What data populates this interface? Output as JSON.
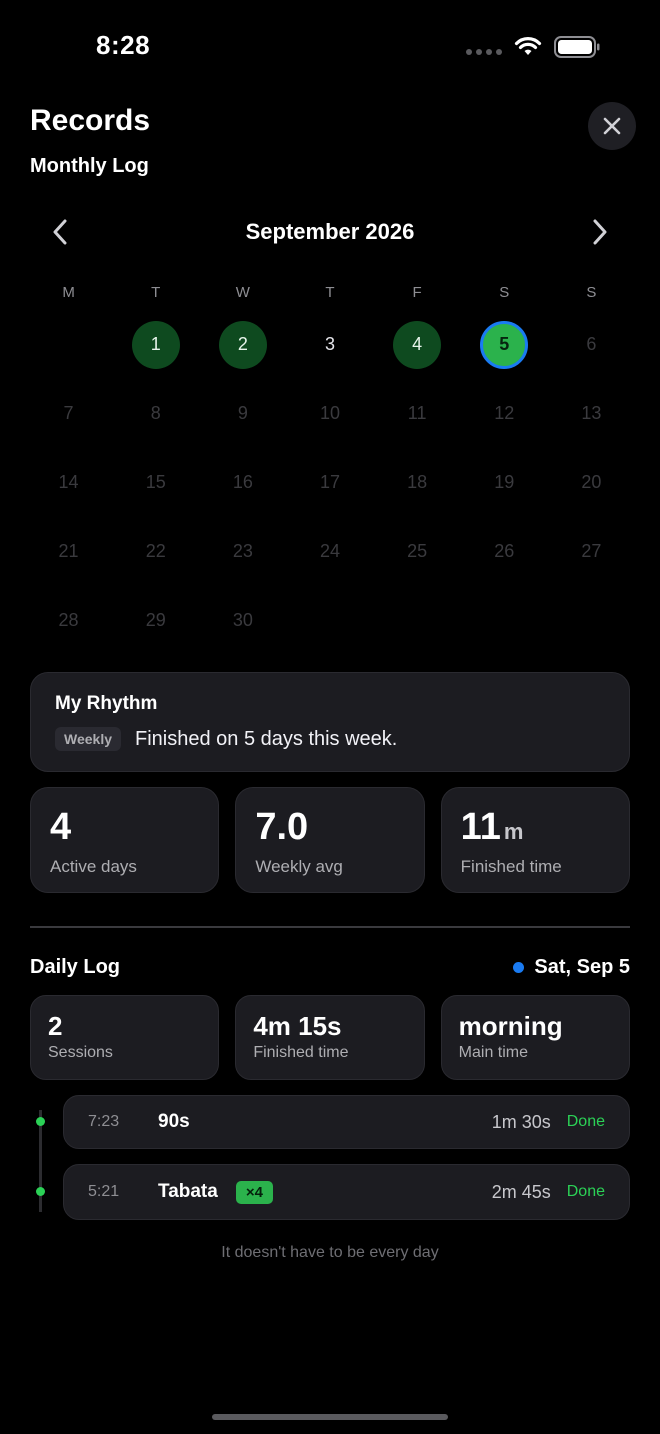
{
  "status_bar": {
    "time": "8:28"
  },
  "header": {
    "title": "Records",
    "subtitle": "Monthly Log"
  },
  "calendar": {
    "month_label": "September 2026",
    "weekdays": [
      "M",
      "T",
      "W",
      "T",
      "F",
      "S",
      "S"
    ],
    "leading_blank_days": 1,
    "days": [
      "1",
      "2",
      "3",
      "4",
      "5",
      "6",
      "7",
      "8",
      "9",
      "10",
      "11",
      "12",
      "13",
      "14",
      "15",
      "16",
      "17",
      "18",
      "19",
      "20",
      "21",
      "22",
      "23",
      "24",
      "25",
      "26",
      "27",
      "28",
      "29",
      "30"
    ],
    "active_days": [
      1,
      2,
      4
    ],
    "selected_day": 5,
    "current_through_day": 5
  },
  "rhythm": {
    "title": "My Rhythm",
    "tag": "Weekly",
    "text": "Finished on 5 days this week."
  },
  "stats": [
    {
      "value": "4",
      "unit": "",
      "label": "Active days"
    },
    {
      "value": "7.0",
      "unit": "",
      "label": "Weekly avg"
    },
    {
      "value": "11",
      "unit": "m",
      "label": "Finished time"
    }
  ],
  "daily": {
    "title": "Daily Log",
    "date": "Sat, Sep 5",
    "stats": [
      {
        "value": "2",
        "label": "Sessions"
      },
      {
        "value": "4m 15s",
        "label": "Finished time"
      },
      {
        "value": "morning",
        "label": "Main time"
      }
    ],
    "sessions": [
      {
        "time": "7:23",
        "name": "90s",
        "badge": "",
        "duration": "1m 30s",
        "status": "Done"
      },
      {
        "time": "5:21",
        "name": "Tabata",
        "badge": "×4",
        "duration": "2m 45s",
        "status": "Done"
      }
    ]
  },
  "footer_note": "It doesn't have to be every day",
  "colors": {
    "active_day": "#0e4a1f",
    "selected_day": "#2bb24c",
    "selected_ring": "#1a7bf2",
    "done": "#2bd156"
  }
}
